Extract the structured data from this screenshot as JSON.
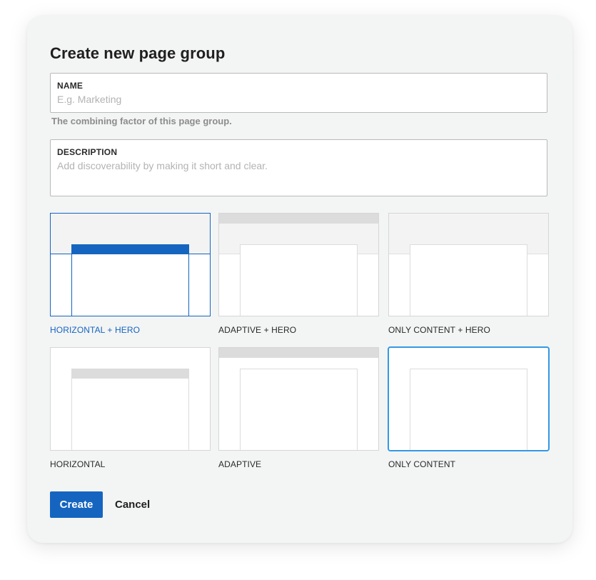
{
  "dialog": {
    "title": "Create new page group"
  },
  "name_field": {
    "label": "NAME",
    "placeholder": "E.g. Marketing",
    "value": "",
    "help": "The combining factor of this page group."
  },
  "description_field": {
    "label": "DESCRIPTION",
    "placeholder": "Add discoverability by making it short and clear.",
    "value": ""
  },
  "layouts": [
    {
      "label": "HORIZONTAL + HERO",
      "selected": true
    },
    {
      "label": "ADAPTIVE + HERO",
      "selected": false
    },
    {
      "label": "ONLY CONTENT + HERO",
      "selected": false
    },
    {
      "label": "HORIZONTAL",
      "selected": false
    },
    {
      "label": "ADAPTIVE",
      "selected": false
    },
    {
      "label": "ONLY CONTENT",
      "selected": false,
      "focused": true
    }
  ],
  "actions": {
    "create_label": "Create",
    "cancel_label": "Cancel"
  },
  "colors": {
    "accent": "#1565c0",
    "focus": "#3399e6",
    "hero_gray": "#f3f3f3",
    "nav_gray": "#dcdcdc"
  }
}
